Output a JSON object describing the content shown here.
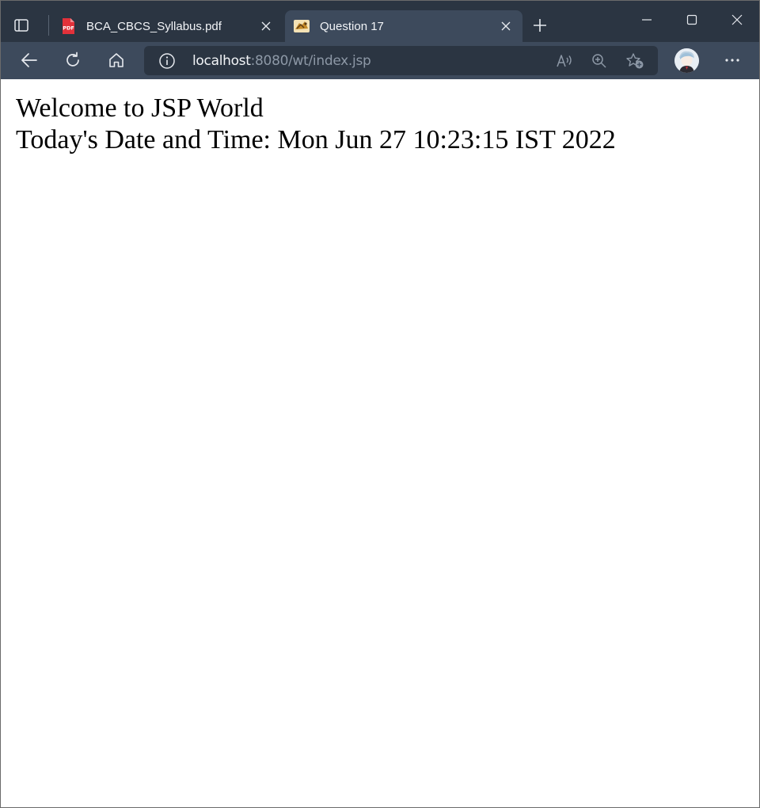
{
  "tabs": [
    {
      "title": "BCA_CBCS_Syllabus.pdf",
      "favicon": "pdf-icon",
      "active": false
    },
    {
      "title": "Question 17",
      "favicon": "tomcat-icon",
      "active": true
    }
  ],
  "address_bar": {
    "host": "localhost",
    "rest": ":8080/wt/index.jsp"
  },
  "page": {
    "line1": "Welcome to JSP World",
    "line2": "Today's Date and Time: Mon Jun 27 10:23:15 IST 2022"
  },
  "colors": {
    "tabstrip": "#2b3542",
    "toolbar": "#3d4a5c",
    "pdf_red": "#e2313a"
  }
}
